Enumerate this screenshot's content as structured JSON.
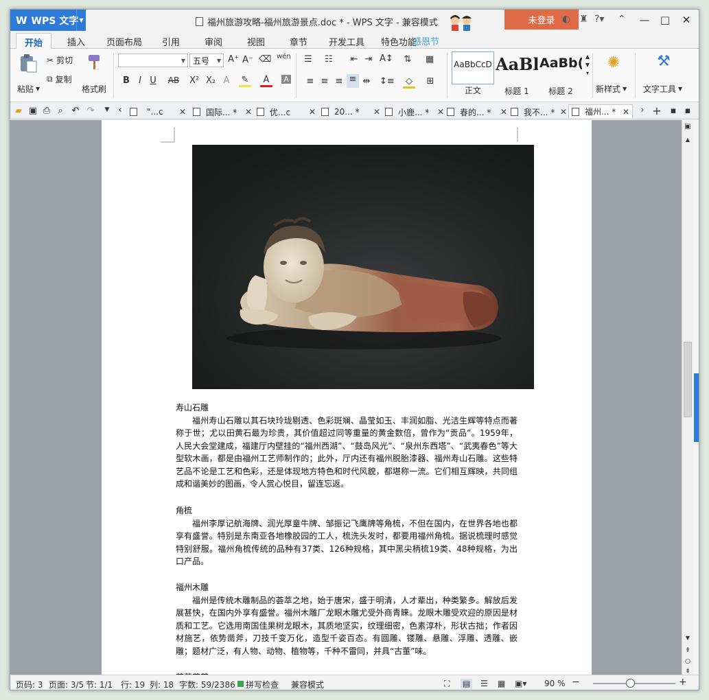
{
  "app": {
    "name": "WPS 文字",
    "window_title": "福州旅游攻略-福州旅游景点.doc * - WPS 文字 - 兼容模式",
    "login_label": "未登录",
    "window_buttons": [
      "—",
      "□",
      "✕"
    ]
  },
  "menu_tabs": [
    "开始",
    "插入",
    "页面布局",
    "引用",
    "审阅",
    "视图",
    "章节",
    "开发工具",
    "特色功能"
  ],
  "festive_text": "感恩节",
  "ribbon": {
    "paste": "粘贴",
    "cut": "剪切",
    "copy": "复制",
    "format_painter": "格式刷",
    "font_name": "",
    "font_size": "五号",
    "bold": "B",
    "italic": "I",
    "underline": "U",
    "strike": "AB",
    "superscript": "X²",
    "subscript": "X₂",
    "font_color_label": "A",
    "styles": [
      {
        "sample": "AaBbCcD",
        "name": "正文"
      },
      {
        "sample": "AaBl",
        "name": "标题 1"
      },
      {
        "sample": "AaBb(",
        "name": "标题 2"
      }
    ],
    "new_style": "新样式",
    "text_tools": "文字工具",
    "phonetic_label": "wén"
  },
  "doc_tabs": [
    {
      "label": "\"...c",
      "active": false
    },
    {
      "label": "国际... *",
      "active": false
    },
    {
      "label": "优...c",
      "active": false
    },
    {
      "label": "20... *",
      "active": false
    },
    {
      "label": "小鹿... *",
      "active": false
    },
    {
      "label": "春的... *",
      "active": false
    },
    {
      "label": "我不... *",
      "active": false
    },
    {
      "label": "福州... *",
      "active": true
    }
  ],
  "document": {
    "sections": [
      {
        "heading": "寿山石雕",
        "body": "福州寿山石雕以其石块玲珑剔透、色彩斑斓、晶莹如玉、丰润如脂、光洁生辉等特点而著称于世；尤以田黄石最为珍贵，其价值超过同等重量的黄金数倍，曾作为“贡品”。1959年，人民大会堂建成，福建厅内壁挂的“福州西湖”、“鼓岛风光”、“泉州东西塔”、“武夷春色”等大型软木画，都是由福州工艺师制作的；此外，厅内还有福州脱胎漆器、福州寿山石雕。这些特艺品不论是工艺和色彩，还是体现地方特色和时代风貌，都堪称一流。它们相互辉映，共同组成和谐美妙的图画，令人赏心悦目，留连忘返。"
      },
      {
        "heading": "角梳",
        "body": "福州李厚记航海牌、润光厚童牛牌、邹振记飞鹰牌等角梳，不但在国内，在世界各地也都享有盛誉。特别是东南亚各地橡胶园的工人，梳洗头发时，都要用福州角梳。据说梳理时感觉特别舒服。福州角梳传统的品种有37类、126种规格，其中黑尖柄梳19类、48种规格，为出口产品。"
      },
      {
        "heading": "福州木雕",
        "body": "福州是传统木雕制品的荟萃之地，始于唐宋，盛于明清，人才辈出，种类繁多。解放后发展甚快，在国内外享有盛誉。福州木雕厂龙眼木雕尤受外商青睐。龙眼木雕受欢迎的原因是材质和工艺。它选用南国佳果树龙眼木，其质地坚实，纹理细密，色素淳朴，形状古拙；作者因材施艺，依势凿斧，刀技千变万化，造型千姿百态。有圆雕、镂雕、悬雕、浮雕、透雕、嵌雕；题材广泛，有人物、动物、植物等，千种不雷同，并具“古董”味。"
      },
      {
        "heading": "茉莉花茶",
        "body": ""
      }
    ]
  },
  "status": {
    "page_code": "页码: 3",
    "page_count": "页面: 3/5",
    "section": "节: 1/1",
    "line": "行: 19",
    "column": "列: 18",
    "word_count": "字数: 59/2386",
    "spell_check": "拼写检查",
    "compat_mode": "兼容模式",
    "zoom": "90 %",
    "zoom_fraction": 0.45
  },
  "colors": {
    "accent": "#2d7bd6",
    "login": "#e06a45",
    "spell_ok": "#3da34d"
  }
}
